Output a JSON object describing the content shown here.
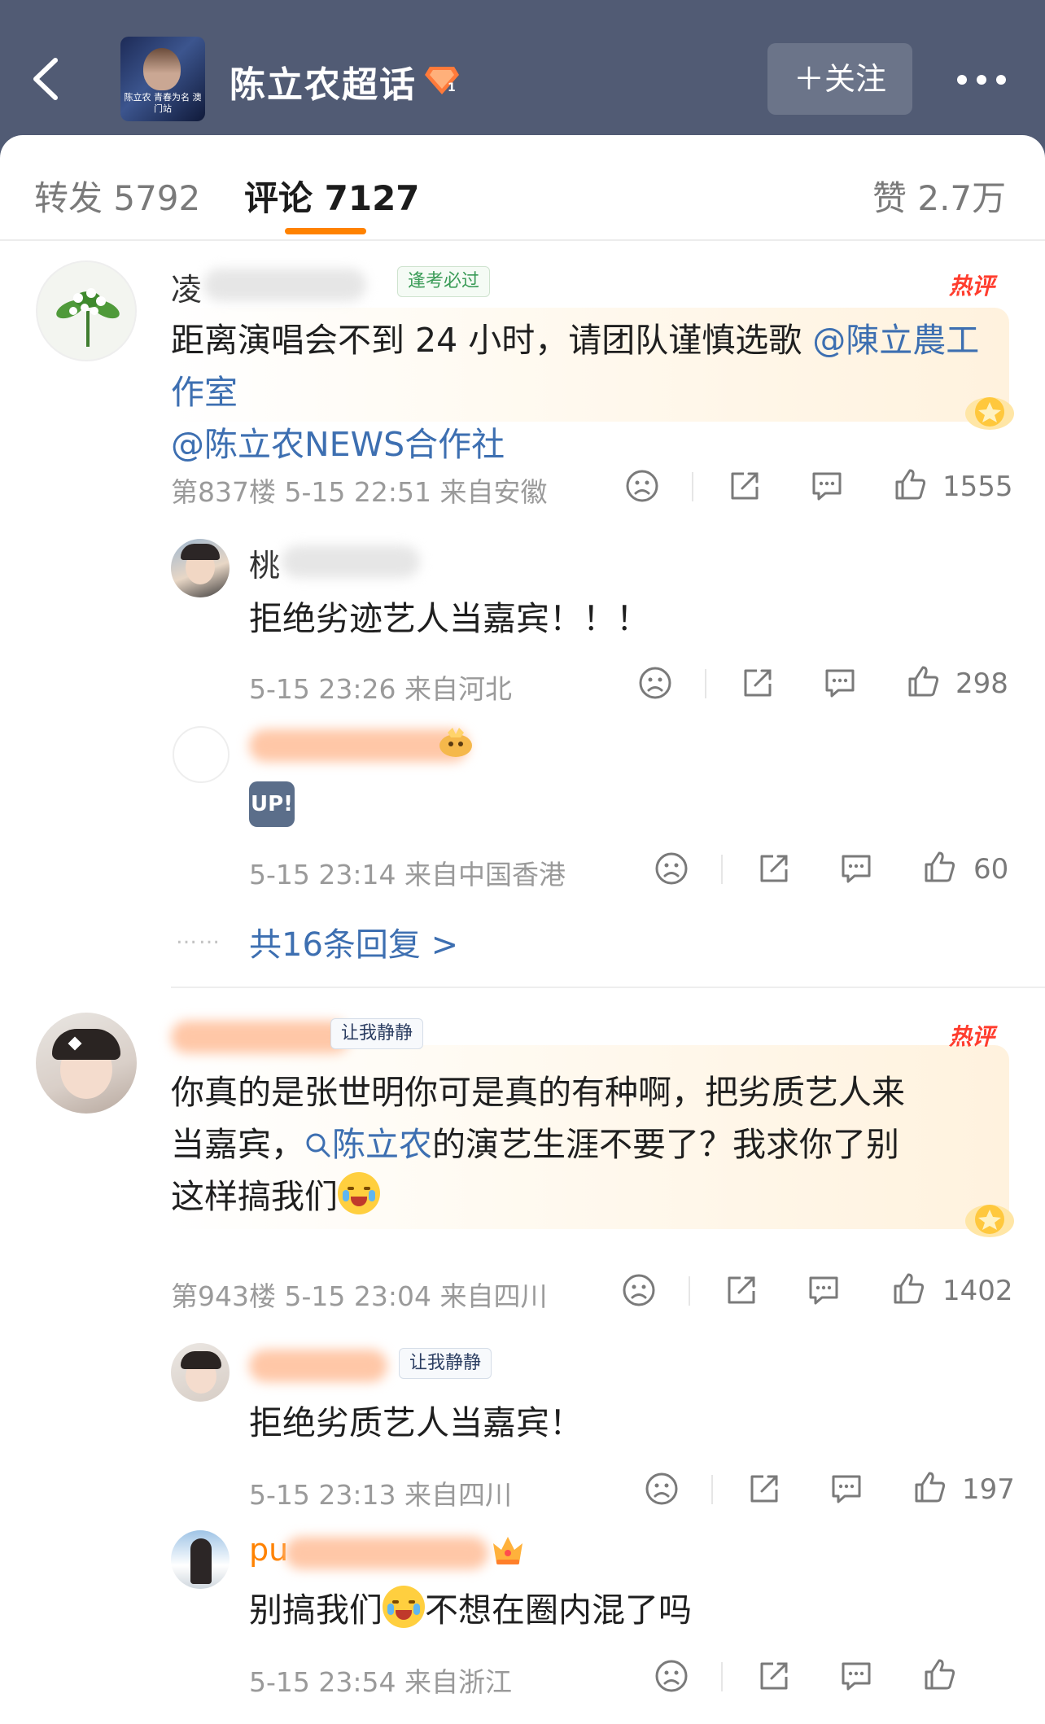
{
  "header": {
    "topic_title": "陈立农超话",
    "cover_caption": "陈立农 青春为名 澳门站",
    "follow_label": "＋关注"
  },
  "tabs": {
    "repost": "转发 5792",
    "comments": "评论 7127",
    "likes": "赞 2.7万"
  },
  "comments": [
    {
      "name_visible": "凌",
      "badge": "逢考必过",
      "hot_label": "热评",
      "body_text": "距离演唱会不到 24 小时，请团队谨慎选歌 ",
      "mention1": "@陳立農工作室",
      "mention2": "@陈立农NEWS合作社",
      "meta": "第837楼 5-15 22:51 来自安徽",
      "likes": "1555",
      "replies": [
        {
          "name_visible": "桃",
          "body": "拒绝劣迹艺人当嘉宾！！！",
          "meta": "5-15 23:26 来自河北",
          "likes": "298"
        },
        {
          "name_visible": "",
          "body_icon": "UP!",
          "meta": "5-15 23:14 来自中国香港",
          "likes": "60"
        }
      ],
      "more_replies": "共16条回复 >"
    },
    {
      "name_visible": "",
      "badge": "让我静静",
      "hot_label": "热评",
      "body_line1": "你真的是张世明你可是真的有种啊，把劣质艺人来",
      "body_line2_pre": "当嘉宾，",
      "body_link": "陈立农",
      "body_line2_post": "的演艺生涯不要了？我求你了别",
      "body_line3": "这样搞我们",
      "meta": "第943楼 5-15 23:04 来自四川",
      "likes": "1402",
      "replies": [
        {
          "badge": "让我静静",
          "body": "拒绝劣质艺人当嘉宾！",
          "meta": "5-15 23:13 来自四川",
          "likes": "197"
        },
        {
          "name_visible": "pu",
          "body_pre": "别搞我们",
          "body_post": "不想在圈内混了吗",
          "meta": "5-15 23:54 来自浙江",
          "likes": ""
        }
      ]
    }
  ]
}
